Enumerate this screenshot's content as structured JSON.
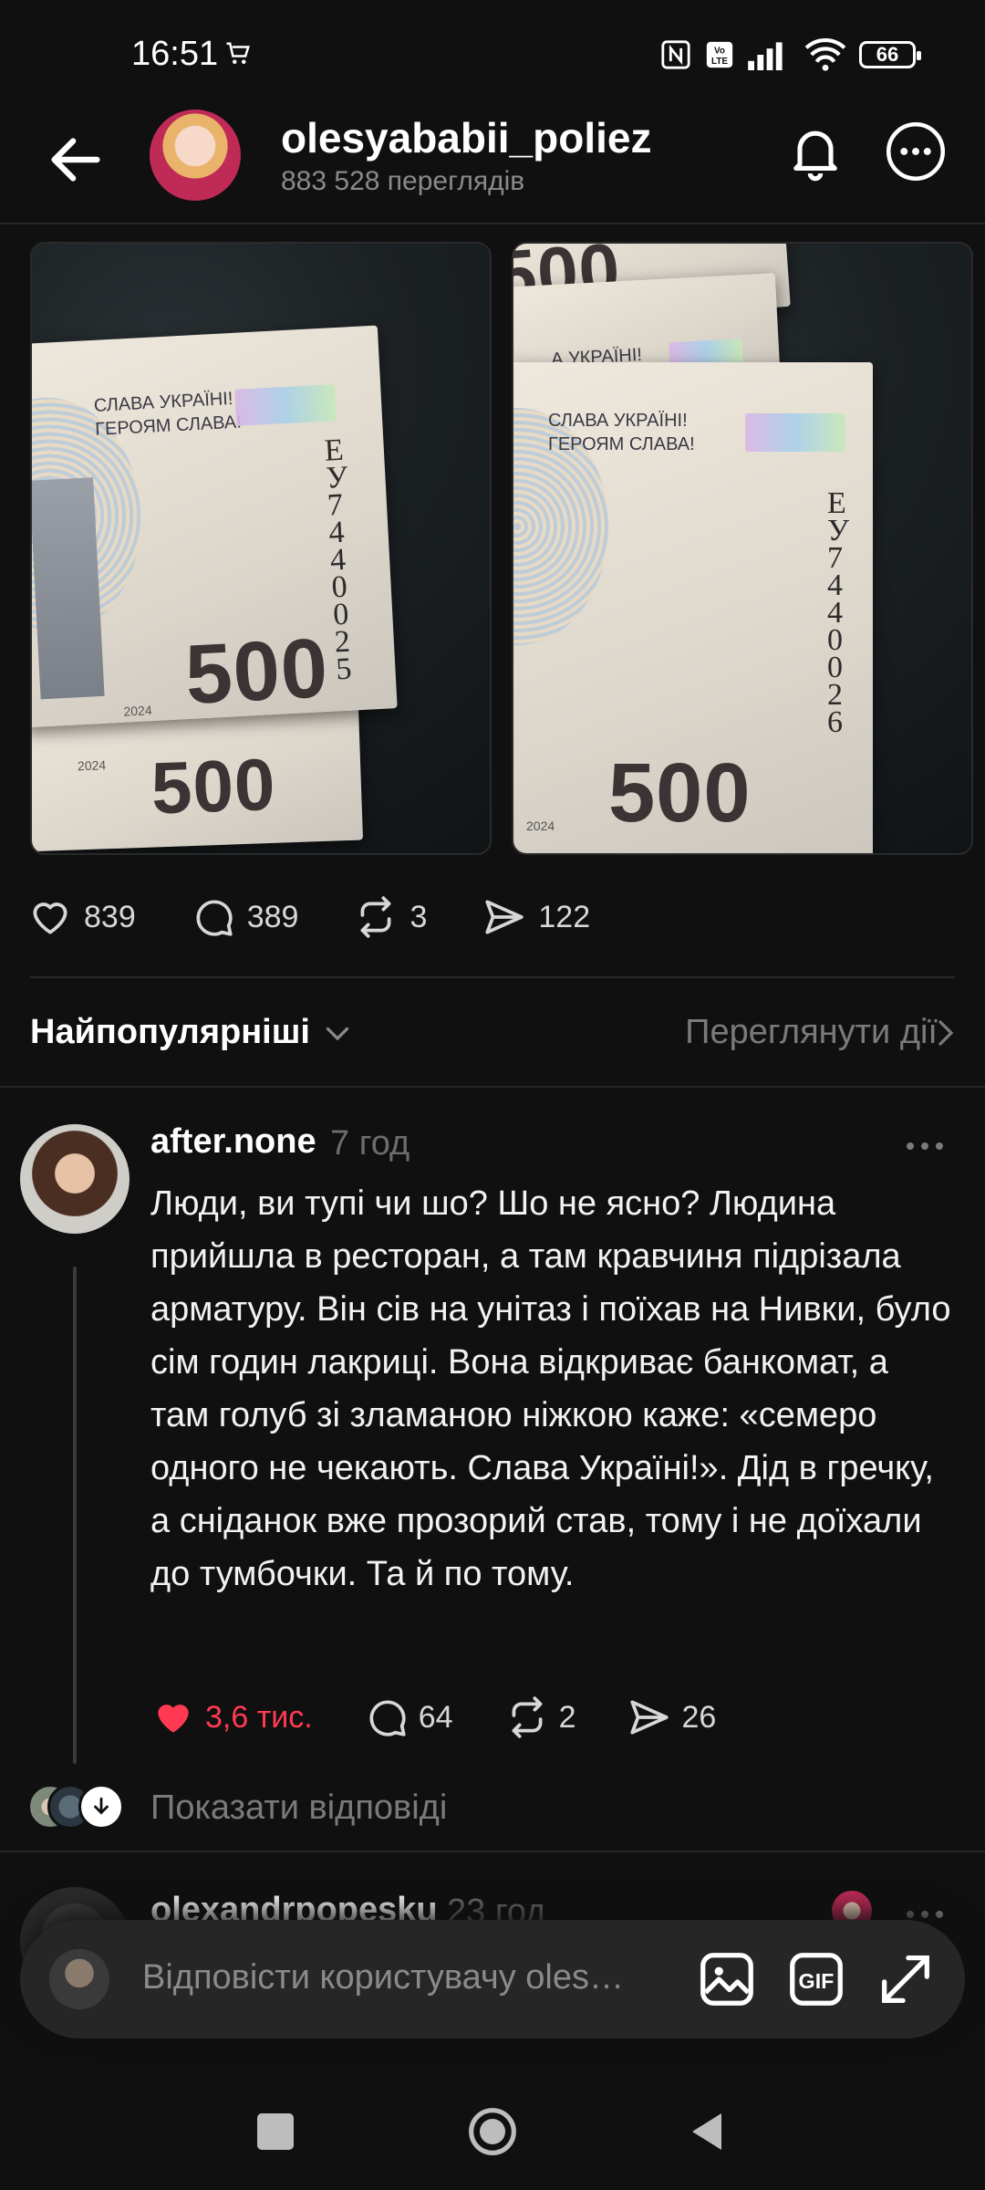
{
  "status_bar": {
    "time": "16:51",
    "battery": "66"
  },
  "header": {
    "username": "olesyababii_poliez",
    "views": "883 528 переглядів"
  },
  "post": {
    "photos": [
      {
        "banknote_text_line1": "СЛАВА УКРАЇНІ!",
        "banknote_text_line2": "ГЕРОЯМ СЛАВА!",
        "denomination": "500",
        "denomination_back": "500",
        "serial": "ЕУ7440025",
        "year": "2024"
      },
      {
        "banknote_text_top": "А УКРАЇНІ!",
        "banknote_text_line1": "СЛАВА УКРАЇНІ!",
        "banknote_text_line2": "ГЕРОЯМ СЛАВА!",
        "denomination": "500",
        "serial": "ЕУ7440026",
        "year": "2024"
      }
    ],
    "likes": "839",
    "comments": "389",
    "reposts": "3",
    "shares": "122"
  },
  "sort": {
    "label": "Найпопулярніші",
    "view_activity": "Переглянути дії"
  },
  "comment": {
    "username": "after.none",
    "time": "7 год",
    "text": "Люди, ви тупі чи шо? Шо не ясно? Людина прийшла в ресторан, а там кравчиня підрізала арматуру. Він сів на унітаз і поїхав на Нивки, було сім годин лакриці. Вона відкриває банкомат, а там голуб зі зламаною ніжкою каже: «семеро одного не чекають. Слава Україні!». Дід в гречку, а сніданок вже прозорий став, тому і не доїхали до тумбочки. Та й по тому.",
    "likes": "3,6 тис.",
    "replies": "64",
    "reposts": "2",
    "shares": "26",
    "show_replies": "Показати відповіді"
  },
  "next_comment": {
    "username": "olexandrpopesku",
    "time": "23 год"
  },
  "reply_box": {
    "placeholder": "Відповісти користувачу oles…"
  },
  "colors": {
    "background": "#101010",
    "like_red": "#ff3a52",
    "muted": "#7a7a7a"
  },
  "icons": [
    "back-icon",
    "bell-icon",
    "more-icon",
    "heart-icon",
    "comment-icon",
    "repost-icon",
    "share-icon",
    "chevron-down-icon",
    "chevron-right-icon",
    "image-icon",
    "gif-icon",
    "expand-icon"
  ]
}
